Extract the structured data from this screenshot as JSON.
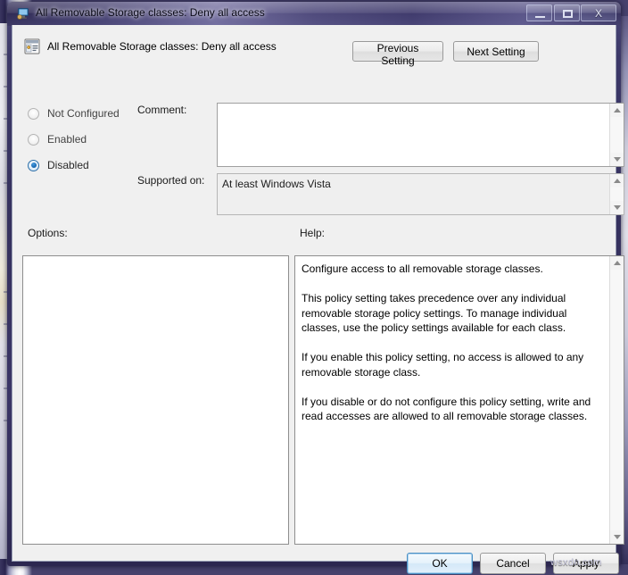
{
  "window": {
    "title": "All Removable Storage classes: Deny all access",
    "title_icon": "computer-monitor-icon",
    "controls": {
      "minimize_label": "Minimize",
      "maximize_label": "Maximize",
      "close_label": "X"
    }
  },
  "header": {
    "icon": "group-policy-setting-icon",
    "policy_title": "All Removable Storage classes: Deny all access",
    "previous_setting_label": "Previous Setting",
    "next_setting_label": "Next Setting"
  },
  "state_options": {
    "items": [
      {
        "label": "Not Configured",
        "selected": false
      },
      {
        "label": "Enabled",
        "selected": false
      },
      {
        "label": "Disabled",
        "selected": true
      }
    ]
  },
  "comment": {
    "label": "Comment:",
    "value": "",
    "placeholder": ""
  },
  "supported_on": {
    "label": "Supported on:",
    "value": "At least Windows Vista"
  },
  "panels": {
    "options_label": "Options:",
    "options_content": "",
    "help_label": "Help:",
    "help_text": "Configure access to all removable storage classes.\n\nThis policy setting takes precedence over any individual removable storage policy settings. To manage individual classes, use the policy settings available for each class.\n\nIf you enable this policy setting, no access is allowed to any removable storage class.\n\nIf you disable or do not configure this policy setting, write and read accesses are allowed to all removable storage classes."
  },
  "footer": {
    "ok_label": "OK",
    "cancel_label": "Cancel",
    "apply_label": "Apply"
  },
  "watermark": {
    "text": "wsxdn.com"
  },
  "colors": {
    "accent": "#1a6bb5",
    "default_button_border": "#4a90c4",
    "dialog_face": "#f0f0f0",
    "titlebar": "#3a3566"
  }
}
